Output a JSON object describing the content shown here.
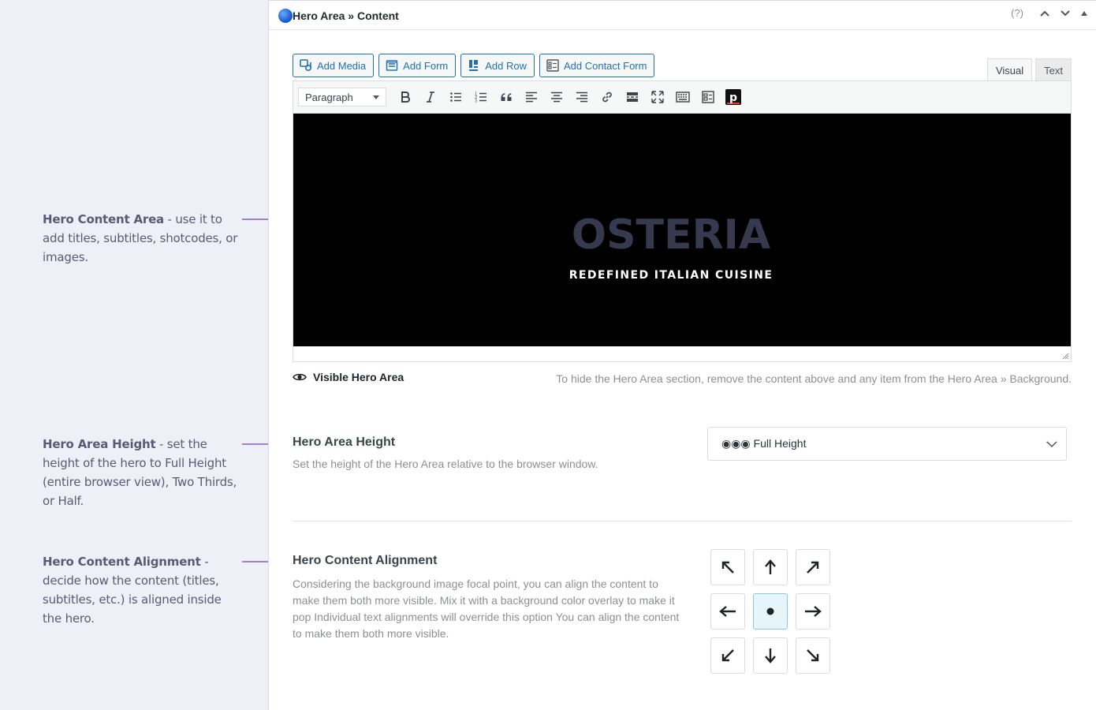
{
  "annotations": [
    {
      "title": "Hero Content Area",
      "text": " - use it to add titles, subtitles, shotcodes, or images."
    },
    {
      "title": "Hero Area Height",
      "text": " - set the height of the hero to Full Height (entire browser view), Two Thirds, or Half."
    },
    {
      "title": "Hero Content Alignment",
      "text": " - decide how the content (titles, subtitles, etc.) is aligned inside the hero."
    }
  ],
  "panel": {
    "title": "Hero Area » Content",
    "help": "(?)"
  },
  "media_buttons": [
    {
      "label": "Add Media",
      "icon": "media-icon"
    },
    {
      "label": "Add Form",
      "icon": "form-icon"
    },
    {
      "label": "Add Row",
      "icon": "row-icon"
    },
    {
      "label": "Add Contact Form",
      "icon": "contact-form-icon"
    }
  ],
  "editor_tabs": {
    "visual": "Visual",
    "text": "Text"
  },
  "toolbar": {
    "format": "Paragraph",
    "icons": [
      "bold-icon",
      "italic-icon",
      "bullet-list-icon",
      "numbered-list-icon",
      "blockquote-icon",
      "align-left-icon",
      "align-center-icon",
      "align-right-icon",
      "link-icon",
      "read-more-icon",
      "fullscreen-icon",
      "toolbar-toggle-icon",
      "shortcode-icon",
      "pixelgrade-icon"
    ]
  },
  "hero": {
    "title": "OSTERIA",
    "subtitle": "REDEFINED ITALIAN CUISINE"
  },
  "visibility": {
    "label": "Visible Hero Area",
    "hint": "To hide the Hero Area section, remove the content above and any item from the Hero Area » Background."
  },
  "height_setting": {
    "title": "Hero Area Height",
    "description": "Set the height of the Hero Area relative to the browser window.",
    "value": "◉◉◉ Full Height"
  },
  "alignment_setting": {
    "title": "Hero Content Alignment",
    "description": "Considering the background image focal point, you can align the content to make them both more visible. Mix it with a background color overlay to make it pop Individual text alignments will override this option You can align the content to make them both more visible.",
    "options": [
      "↖",
      "🠕",
      "↗",
      "🠔",
      "●",
      "🠖",
      "↙",
      "🠗",
      "↘"
    ],
    "selected": "middle-center"
  },
  "colors": {
    "accent": "#2271b1",
    "annotation_arrow": "#8e5bbf",
    "hero_bg": "#000000",
    "hero_title": "#373a4e",
    "selected_cell": "#e5f5fa"
  }
}
